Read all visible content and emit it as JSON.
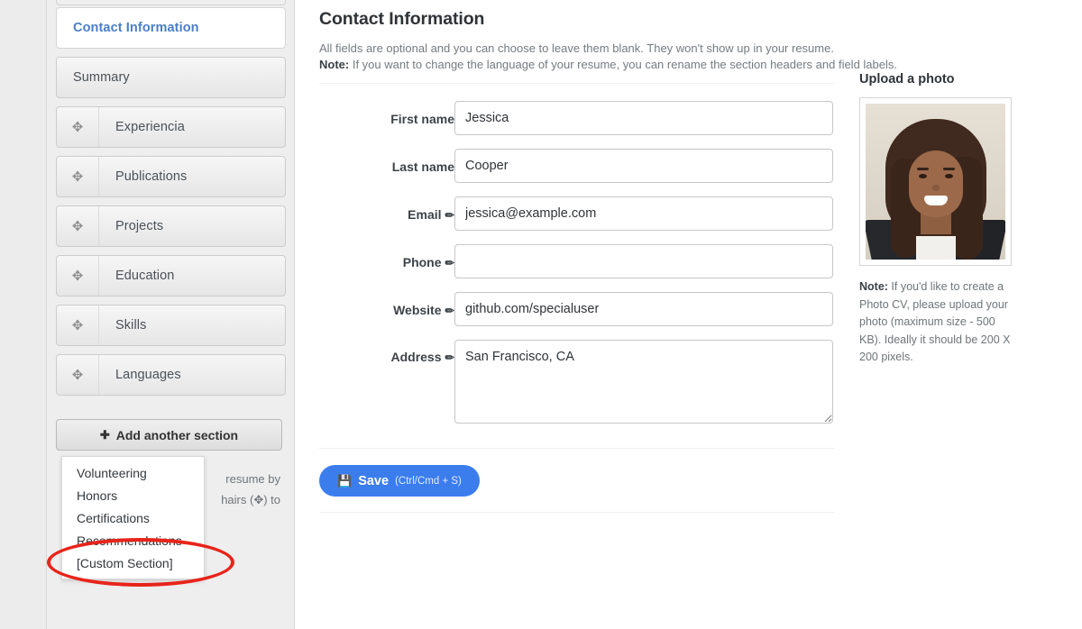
{
  "sidebar": {
    "items": [
      {
        "label": "Contact Information",
        "active": true,
        "draggable": false
      },
      {
        "label": "Summary",
        "active": false,
        "draggable": false
      },
      {
        "label": "Experiencia",
        "active": false,
        "draggable": true
      },
      {
        "label": "Publications",
        "active": false,
        "draggable": true
      },
      {
        "label": "Projects",
        "active": false,
        "draggable": true
      },
      {
        "label": "Education",
        "active": false,
        "draggable": true
      },
      {
        "label": "Skills",
        "active": false,
        "draggable": true
      },
      {
        "label": "Languages",
        "active": false,
        "draggable": true
      }
    ],
    "add_section_button": {
      "label": "Add another section",
      "icon": "plus-circle-icon"
    },
    "helper_text_line1": "resume by",
    "helper_text_line2": "hairs (✥) to",
    "dropdown": {
      "options": [
        "Volunteering",
        "Honors",
        "Certifications",
        "Recommendations",
        "[Custom Section]"
      ],
      "highlighted_option": "[Custom Section]"
    },
    "drag_handle_icon": "move-crosshair-icon"
  },
  "main": {
    "title": "Contact Information",
    "subtitle_line1": "All fields are optional and you can choose to leave them blank. They won't show up in your resume.",
    "note_label": "Note:",
    "subtitle_line2": " If you want to change the language of your resume, you can rename the section headers and field labels.",
    "fields": [
      {
        "label": "First name",
        "value": "Jessica",
        "editable_label": false,
        "type": "text",
        "placeholder": ""
      },
      {
        "label": "Last name",
        "value": "Cooper",
        "editable_label": false,
        "type": "text",
        "placeholder": ""
      },
      {
        "label": "Email",
        "value": "jessica@example.com",
        "editable_label": true,
        "type": "text",
        "placeholder": ""
      },
      {
        "label": "Phone",
        "value": "",
        "editable_label": true,
        "type": "text",
        "placeholder": ""
      },
      {
        "label": "Website",
        "value": "github.com/specialuser",
        "editable_label": true,
        "type": "text",
        "placeholder": ""
      },
      {
        "label": "Address",
        "value": "San Francisco, CA",
        "editable_label": true,
        "type": "textarea",
        "placeholder": ""
      }
    ],
    "pencil_icon": "✏",
    "save": {
      "icon": "floppy-disk-icon",
      "label": "Save",
      "hint": "(Ctrl/Cmd + S)"
    }
  },
  "photo": {
    "title": "Upload a photo",
    "note_label": "Note:",
    "note_text": " If you'd like to create a Photo CV, please upload your photo (maximum size - 500 KB). Ideally it should be 200 X 200 pixels.",
    "image_alt": "portrait-photo"
  },
  "annotation": {
    "shape": "ellipse",
    "color": "#e8241a",
    "target": "[Custom Section]"
  },
  "colors": {
    "accent_blue": "#3b7ded",
    "active_tab_text": "#4a7ec8",
    "annotation_red": "#e8241a",
    "sidebar_bg": "#eeeeee",
    "page_bg": "#ffffff"
  }
}
